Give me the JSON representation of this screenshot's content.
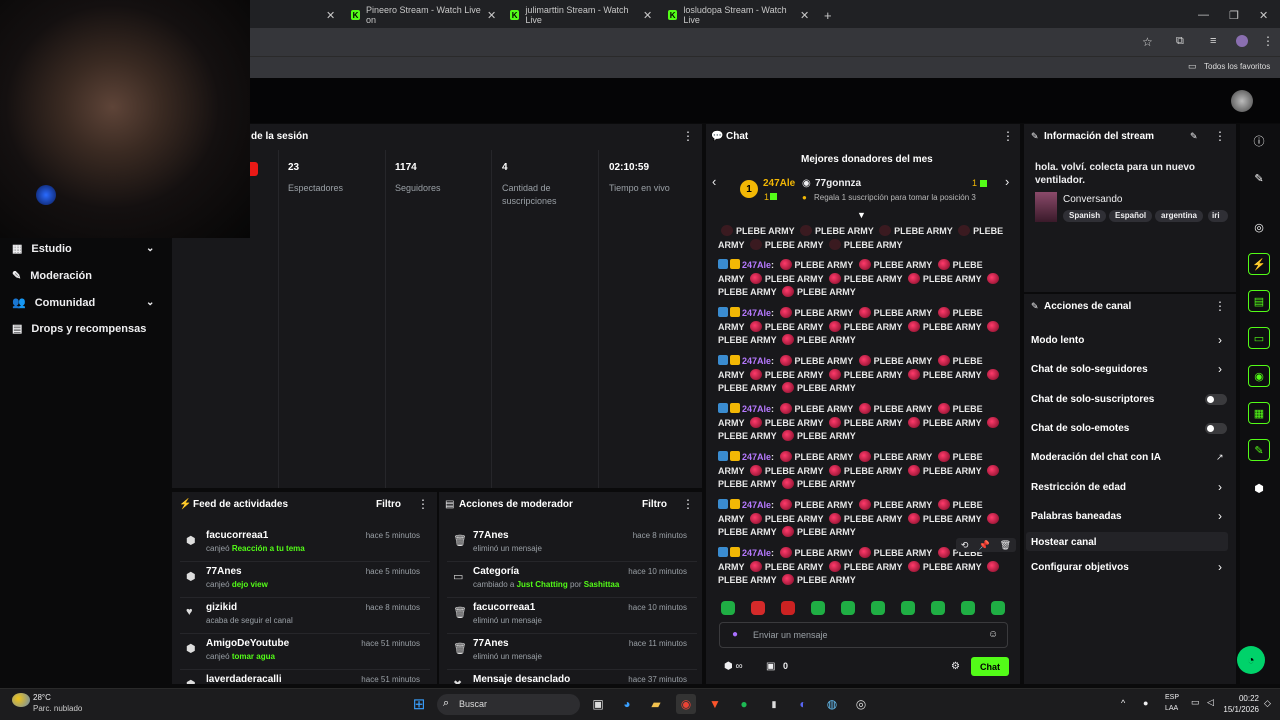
{
  "browser": {
    "tabs": [
      {
        "title": "Pineero Stream - Watch Live on"
      },
      {
        "title": "julimarttin Stream - Watch Live"
      },
      {
        "title": "losludopa Stream - Watch Live"
      }
    ],
    "bookmarks_label": "Todos los favoritos"
  },
  "session": {
    "title": "de la sesión",
    "stats": [
      {
        "value": "23",
        "label": "Espectadores"
      },
      {
        "value": "1174",
        "label": "Seguidores"
      },
      {
        "value": "4",
        "label": "Cantidad de suscripciones"
      },
      {
        "value": "02:10:59",
        "label": "Tiempo en vivo"
      }
    ]
  },
  "sidebar": {
    "items": [
      {
        "label": "Estudio"
      },
      {
        "label": "Moderación"
      },
      {
        "label": "Comunidad"
      },
      {
        "label": "Drops y recompensas"
      }
    ]
  },
  "activity_feed": {
    "title": "Feed de actividades",
    "filter_label": "Filtro",
    "items": [
      {
        "name": "facucorreaa1",
        "action": "canjeó",
        "highlight": "Reacción a tu tema",
        "time": "hace 5 minutos"
      },
      {
        "name": "77Anes",
        "action": "canjeó",
        "highlight": "dejo view",
        "time": "hace 5 minutos"
      },
      {
        "name": "gizikid",
        "action": "acaba de seguir el canal",
        "highlight": "",
        "time": "hace 8 minutos"
      },
      {
        "name": "AmigoDeYoutube",
        "action": "canjeó",
        "highlight": "tomar agua",
        "time": "hace 51 minutos"
      },
      {
        "name": "laverdaderacalli",
        "action": "",
        "highlight": "",
        "time": "hace 51 minutos"
      }
    ]
  },
  "mod_actions": {
    "title": "Acciones de moderador",
    "filter_label": "Filtro",
    "items": [
      {
        "name": "77Anes",
        "detail": "eliminó un mensaje",
        "time": "hace 8 minutos"
      },
      {
        "name": "Categoría",
        "detail": "cambiado a",
        "hl1": "Just Chatting",
        "mid": "por",
        "hl2": "Sashittaa",
        "time": "hace 10 minutos"
      },
      {
        "name": "facucorreaa1",
        "detail": "eliminó un mensaje",
        "time": "hace 10 minutos"
      },
      {
        "name": "77Anes",
        "detail": "eliminó un mensaje",
        "time": "hace 11 minutos"
      },
      {
        "name": "Mensaje desanclado",
        "detail": "",
        "time": "hace 37 minutos"
      }
    ]
  },
  "chat": {
    "title": "Chat",
    "donors_title": "Mejores donadores del mes",
    "donor_rank": "1",
    "donor_name": "247Ale",
    "donor_count": "1",
    "donor2_name": "77gonnza",
    "donor2_count": "1",
    "donor2_hint": "Regala 1 suscripción para tomar la posición 3",
    "message_user": "247Ale",
    "message_text": "PLEBE ARMY",
    "input_placeholder": "Enviar un mensaje",
    "footer_count": "0",
    "send_label": "Chat"
  },
  "stream_info": {
    "title": "Información del stream",
    "description": "hola. volví. colecta para un nuevo ventilador.",
    "category": "Conversando",
    "tags": [
      "Spanish",
      "Español",
      "argentina",
      "iri"
    ]
  },
  "channel_actions": {
    "title": "Acciones de canal",
    "items": [
      {
        "label": "Modo lento"
      },
      {
        "label": "Chat de solo-seguidores"
      },
      {
        "label": "Chat de solo-suscriptores"
      },
      {
        "label": "Chat de solo-emotes"
      },
      {
        "label": "Moderación del chat con IA"
      },
      {
        "label": "Restricción de edad"
      },
      {
        "label": "Palabras baneadas"
      },
      {
        "label": "Hostear canal"
      },
      {
        "label": "Configurar objetivos"
      }
    ]
  },
  "taskbar": {
    "weather_temp": "28°C",
    "weather_desc": "Parc. nublado",
    "search_label": "Buscar",
    "lang": "ESP",
    "lang2": "LAA",
    "time": "00:22",
    "date": "15/1/2026"
  },
  "colors": {
    "accent": "#53fc18",
    "panel": "#18181b",
    "username": "#b679ff"
  }
}
